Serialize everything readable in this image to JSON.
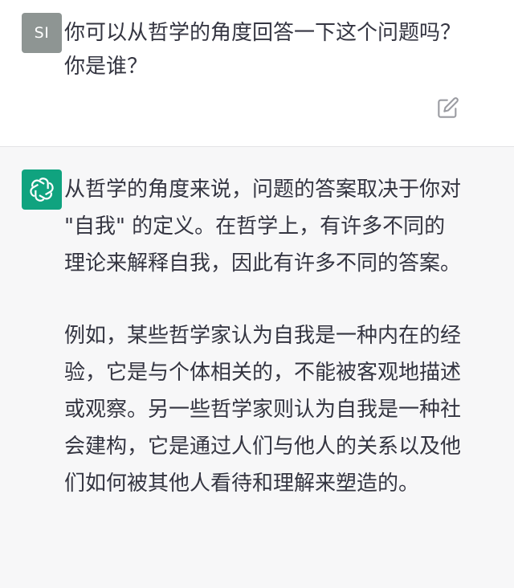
{
  "user_message": {
    "avatar_initials": "SI",
    "text": "你可以从哲学的角度回答一下这个问题吗？你是谁？"
  },
  "assistant_message": {
    "paragraphs": [
      "从哲学的角度来说，问题的答案取决于你对 \"自我\" 的定义。在哲学上，有许多不同的理论来解释自我，因此有许多不同的答案。",
      "例如，某些哲学家认为自我是一种内在的经验，它是与个体相关的，不能被客观地描述或观察。另一些哲学家则认为自我是一种社会建构，它是通过人们与他人的关系以及他们如何被其他人看待和理解来塑造的。"
    ]
  },
  "icons": {
    "edit": "edit-icon",
    "assistant_logo": "openai-logo-icon"
  },
  "colors": {
    "assistant_avatar_bg": "#10a37f",
    "user_avatar_bg": "#8e9593",
    "assistant_bg": "#f7f7f8"
  }
}
